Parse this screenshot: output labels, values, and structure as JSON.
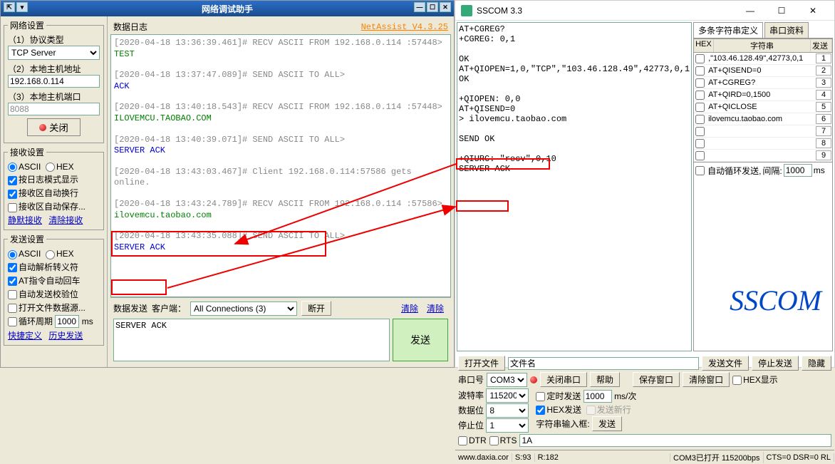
{
  "left": {
    "title": "网络调试助手",
    "netassist": "NetAssist V4.3.25",
    "netset": {
      "legend": "网络设置",
      "proto_label": "（1）协议类型",
      "proto_value": "TCP Server",
      "host_label": "（2）本地主机地址",
      "host_value": "192.168.0.114",
      "port_label": "（3）本地主机端口",
      "port_value": "8088",
      "close_btn": "关闭"
    },
    "recvset": {
      "legend": "接收设置",
      "ascii": "ASCII",
      "hex": "HEX",
      "opt1": "按日志模式显示",
      "opt2": "接收区自动换行",
      "opt3": "接收区自动保存...",
      "silent": "静默接收",
      "clear": "清除接收"
    },
    "sendset": {
      "legend": "发送设置",
      "ascii": "ASCII",
      "hex": "HEX",
      "opt1": "自动解析转义符",
      "opt2": "AT指令自动回车",
      "opt3": "自动发送校验位",
      "opt4": "打开文件数据源...",
      "opt5": "循环周期",
      "period": "1000",
      "ms": "ms",
      "quick": "快捷定义",
      "history": "历史发送"
    },
    "loghead": "数据日志",
    "logs": [
      {
        "h": "[2020-04-18 13:36:39.461]# RECV ASCII FROM 192.168.0.114 :57448>",
        "b": "TEST",
        "bc": "c-green"
      },
      {
        "h": "[2020-04-18 13:37:47.089]# SEND ASCII TO ALL>",
        "b": "ACK",
        "bc": "c-blue"
      },
      {
        "h": "[2020-04-18 13:40:18.543]# RECV ASCII FROM 192.168.0.114 :57448>",
        "b": "ILOVEMCU.TAOBAO.COM",
        "bc": "c-green"
      },
      {
        "h": "[2020-04-18 13:40:39.071]# SEND ASCII TO ALL>",
        "b": "SERVER ACK",
        "bc": "c-blue"
      },
      {
        "h": "[2020-04-18 13:43:03.467]# Client 192.168.0.114:57586 gets online.",
        "b": "",
        "bc": ""
      },
      {
        "h": "[2020-04-18 13:43:24.789]# RECV ASCII FROM 192.168.0.114 :57586>",
        "b": "ilovemcu.taobao.com",
        "bc": "c-green"
      },
      {
        "h": "[2020-04-18 13:43:35.088]# SEND ASCII TO ALL>",
        "b": "SERVER ACK",
        "bc": "c-blue"
      }
    ],
    "bsend": {
      "label": "数据发送",
      "client": "客户端：",
      "connsel": "All Connections (3)",
      "disconnect": "断开",
      "clearbtn1": "清除",
      "clearbtn2": "清除",
      "textarea": "SERVER ACK",
      "bigsend": "发送"
    }
  },
  "right": {
    "title": "SSCOM 3.3",
    "log": "AT+CGREG?\n+CGREG: 0,1\n\nOK\nAT+QIOPEN=1,0,\"TCP\",\"103.46.128.49\",42773,0,1\nOK\n\n+QIOPEN: 0,0\nAT+QISEND=0\n> ilovemcu.taobao.com\n\nSEND OK\n\n+QIURC: \"recv\",0,10\nSERVER ACK",
    "side": {
      "tab1": "多条字符串定义",
      "tab2": "串口资料",
      "h1": "HEX",
      "h2": "字符串",
      "h3": "发送",
      "rows": [
        ",\"103.46.128.49\",42773,0,1",
        "AT+QISEND=0",
        "AT+CGREG?",
        "AT+QIRD=0,1500",
        "AT+QICLOSE",
        "ilovemcu.taobao.com",
        "",
        "",
        ""
      ],
      "loop": "自动循环发送,",
      "interval_lbl": "间隔:",
      "interval": "1000",
      "ms": "ms"
    },
    "ctrl": {
      "openfile": "打开文件",
      "filename": "文件名",
      "sendfile": "发送文件",
      "stopsend": "停止发送",
      "hide": "隐藏",
      "portlbl": "串口号",
      "port": "COM3",
      "closeport": "关闭串口",
      "help": "帮助",
      "savewin": "保存窗口",
      "clearwin": "清除窗口",
      "hexshow": "HEX显示",
      "baud_lbl": "波特率",
      "baud": "115200",
      "databit_lbl": "数据位",
      "databit": "8",
      "stopbit_lbl": "停止位",
      "stopbit": "1",
      "timed": "定时发送",
      "timed_v": "1000",
      "timed_u": "ms/次",
      "hexsend": "HEX发送",
      "sendnl": "发送新行",
      "dtr": "DTR",
      "rts": "RTS",
      "strinput_lbl": "字符串输入框:",
      "sendbtn": "发送",
      "strinput": "1A",
      "logo": "SSCOM"
    },
    "status": {
      "url": "www.daxia.cor",
      "s": "S:93",
      "r": "R:182",
      "port": "COM3已打开 115200bps",
      "cts": "CTS=0 DSR=0 RL"
    }
  }
}
